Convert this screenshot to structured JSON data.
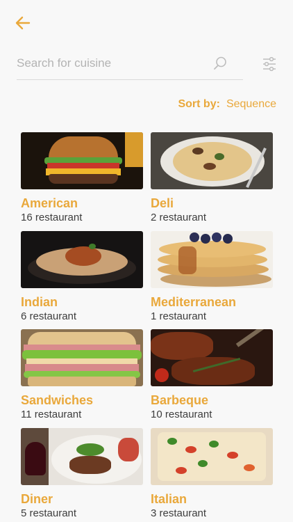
{
  "header": {
    "back_icon": "arrow-left-icon"
  },
  "search": {
    "placeholder": "Search for cuisine",
    "value": ""
  },
  "sort": {
    "label": "Sort by:",
    "value": "Sequence"
  },
  "colors": {
    "accent": "#e9a83b",
    "text": "#3d3d3d",
    "background": "#f8f8f8"
  },
  "cuisines": [
    {
      "name": "American",
      "count": "16 restaurant"
    },
    {
      "name": "Deli",
      "count": "2 restaurant"
    },
    {
      "name": "Indian",
      "count": "6 restaurant"
    },
    {
      "name": "Mediterranean",
      "count": "1 restaurant"
    },
    {
      "name": "Sandwiches",
      "count": "11 restaurant"
    },
    {
      "name": "Barbeque",
      "count": "10 restaurant"
    },
    {
      "name": "Diner",
      "count": "5 restaurant"
    },
    {
      "name": "Italian",
      "count": "3 restaurant"
    }
  ]
}
